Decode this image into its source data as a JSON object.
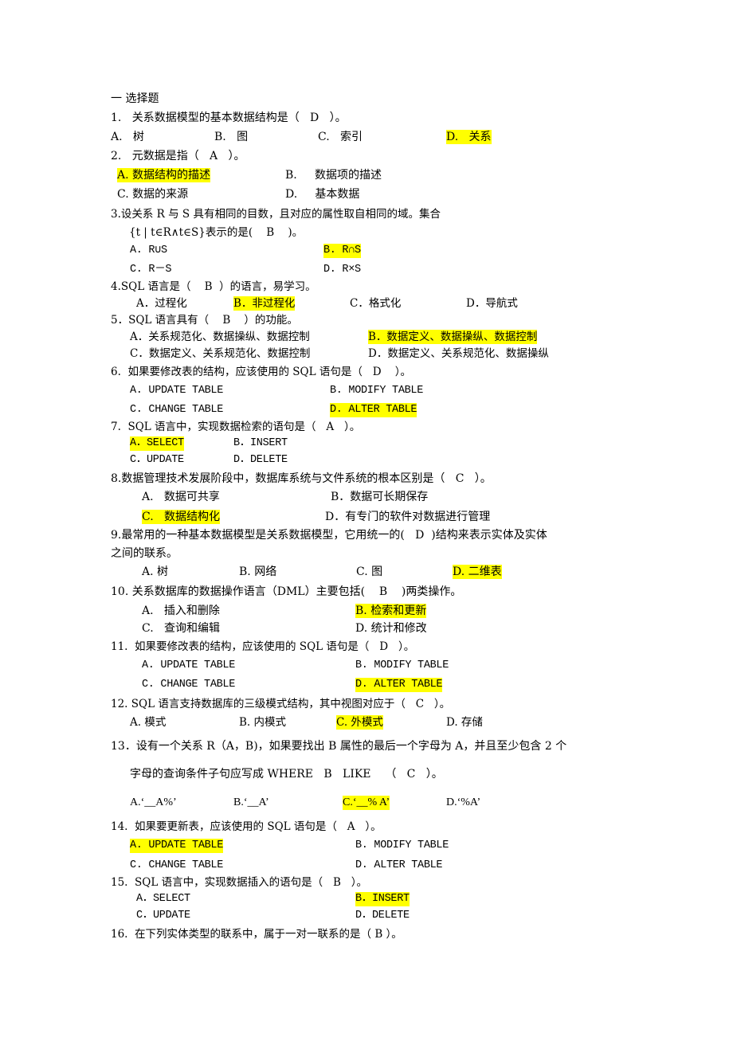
{
  "section_title": "一 选择题",
  "highlight_color": "#ffff00",
  "questions": [
    {
      "stem": "1.   关系数据模型的基本数据结构是（   D   ）。",
      "options": [
        "A.   树",
        "B.   图",
        "C.   索引",
        "D.   关系"
      ],
      "answer": "D"
    },
    {
      "stem": "2.   元数据是指（   A   ）。",
      "options": [
        "A. 数据结构的描述",
        "B.     数据项的描述",
        "C. 数据的来源",
        "D.     基本数据"
      ],
      "answer": "A"
    },
    {
      "stem": "3.设关系 R 与 S 具有相同的目数，且对应的属性取自相同的域。集合",
      "stem2": "{t | t∈R∧t∈S}表示的是(    B    )。",
      "options": [
        "A. R∪S",
        "B. R∩S",
        "C. R－S",
        "D. R×S"
      ],
      "answer": "B"
    },
    {
      "stem": "4.SQL 语言是（    B  ）的语言，易学习。",
      "options": [
        "A．过程化",
        "B．非过程化",
        "C．格式化",
        "D．导航式"
      ],
      "answer": "B"
    },
    {
      "stem": "5．SQL 语言具有（    B    ）的功能。",
      "options": [
        "A．关系规范化、数据操纵、数据控制",
        "B．数据定义、数据操纵、数据控制",
        "C．数据定义、关系规范化、数据控制",
        "D．数据定义、关系规范化、数据操纵"
      ],
      "answer": "B"
    },
    {
      "stem": "6.  如果要修改表的结构，应该使用的 SQL 语句是（   D    ）。",
      "options": [
        "A. UPDATE TABLE",
        "B. MODIFY TABLE",
        "C. CHANGE TABLE",
        "D. ALTER TABLE"
      ],
      "answer": "D"
    },
    {
      "stem": "7.  SQL 语言中，实现数据检索的语句是（   A   ）。",
      "options": [
        "A．SELECT",
        "B．INSERT",
        "C．UPDATE",
        "D．DELETE"
      ],
      "answer": "A"
    },
    {
      "stem": "8.数据管理技术发展阶段中，数据库系统与文件系统的根本区别是（   C   ）。",
      "options": [
        "A.   数据可共享",
        "B．数据可长期保存",
        "C.   数据结构化",
        "D．有专门的软件对数据进行管理"
      ],
      "answer": "C"
    },
    {
      "stem": "9.最常用的一种基本数据模型是关系数据模型，它用统一的(   D  )结构来表示实体及实体",
      "stem2": "之间的联系。",
      "options": [
        "A. 树",
        "B. 网络",
        "C. 图",
        "D. 二维表"
      ],
      "answer": "D"
    },
    {
      "stem": "10. 关系数据库的数据操作语言（DML）主要包括(    B    )两类操作。",
      "options": [
        "A.   插入和删除",
        "B. 检索和更新",
        "C.   查询和编辑",
        "D. 统计和修改"
      ],
      "answer": "B"
    },
    {
      "stem": "11.  如果要修改表的结构，应该使用的 SQL 语句是（   D   ）。",
      "options": [
        "A. UPDATE TABLE",
        "B. MODIFY TABLE",
        "C. CHANGE TABLE",
        "D. ALTER TABLE"
      ],
      "answer": "D"
    },
    {
      "stem": "12. SQL 语言支持数据库的三级模式结构，其中视图对应于（   C   ）。",
      "options": [
        "A. 模式",
        "B. 内模式",
        "C. 外模式",
        "D. 存储"
      ],
      "answer": "C"
    },
    {
      "stem": "13．设有一个关系 R（A，B)，如果要找出 B 属性的最后一个字母为 A，并且至少包含 2 个",
      "stem2": "字母的查询条件子句应写成 WHERE   B   LIKE    （   C   ）。",
      "options": [
        "A.‘__A%’",
        "B.‘__A’",
        "C.‘__% A’",
        "D.‘%A’"
      ],
      "answer": "C"
    },
    {
      "stem": "14.  如果要更新表，应该使用的 SQL 语句是（   A   ）。",
      "options": [
        "A. UPDATE TABLE",
        "B. MODIFY TABLE",
        "C. CHANGE TABLE",
        "D. ALTER TABLE"
      ],
      "answer": "A"
    },
    {
      "stem": "15.  SQL 语言中，实现数据插入的语句是（   B   ）。",
      "options": [
        "A．SELECT",
        "B．INSERT",
        "C．UPDATE",
        "D．DELETE"
      ],
      "answer": "B"
    },
    {
      "stem": "16.  在下列实体类型的联系中，属于一对一联系的是（ B ）。",
      "answer": "B"
    }
  ]
}
